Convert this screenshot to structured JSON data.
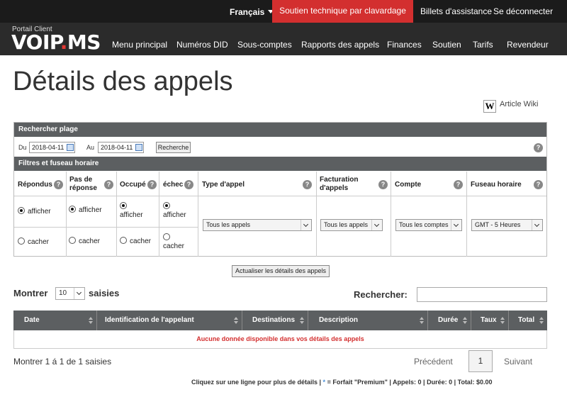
{
  "topbar": {
    "language": "Français",
    "chat": "Soutien technique par clavardage",
    "tickets": "Billets d'assistance",
    "logout": "Se déconnecter"
  },
  "brand": {
    "portal": "Portail Client",
    "logo_white_a": "VOIP",
    "logo_red": ".",
    "logo_white_b": "MS"
  },
  "nav": [
    "Menu principal",
    "Numéros DID",
    "Sous-comptes",
    "Rapports des appels",
    "Finances",
    "Soutien",
    "Tarifs",
    "Revendeur"
  ],
  "page": {
    "title": "Détails des appels",
    "wiki_icon": "W",
    "wiki": "Article Wiki"
  },
  "range": {
    "header": "Rechercher plage",
    "from_label": "Du",
    "from_value": "2018-04-11",
    "to_label": "Au",
    "to_value": "2018-04-11",
    "search_button": "Recherche"
  },
  "filters": {
    "header": "Filtres et fuseau horaire",
    "answered": "Répondus",
    "noanswer": "Pas de réponse",
    "busy": "Occupé",
    "failed": "échec",
    "calltype": "Type d'appel",
    "billing": "Facturation d'appels",
    "account": "Compte",
    "timezone": "Fuseau horaire",
    "show": "afficher",
    "hide": "cacher",
    "calltype_value": "Tous les appels",
    "billing_value": "Tous les appels",
    "account_value": "Tous les comptes",
    "timezone_value": "GMT - 5 Heures",
    "help": "?"
  },
  "update_button": "Actualiser les détails des appels",
  "table": {
    "show": "Montrer",
    "length": "10",
    "entries": "saisies",
    "search_label": "Rechercher:",
    "columns": [
      "Date",
      "Identification de l'appelant",
      "Destinations",
      "Description",
      "Durée",
      "Taux",
      "Total"
    ],
    "empty": "Aucune donnée disponible dans vos détails des appels",
    "info": "Montrer 1 á 1 de 1 saisies",
    "prev": "Précédent",
    "page": "1",
    "next": "Suivant"
  },
  "footer": {
    "text_a": "Cliquez sur une ligne pour plus de détails | ",
    "star": "*",
    "text_b": " = Forfait \"Premium\" | Appels: 0 | Durée: 0 | Total: $0.00"
  }
}
